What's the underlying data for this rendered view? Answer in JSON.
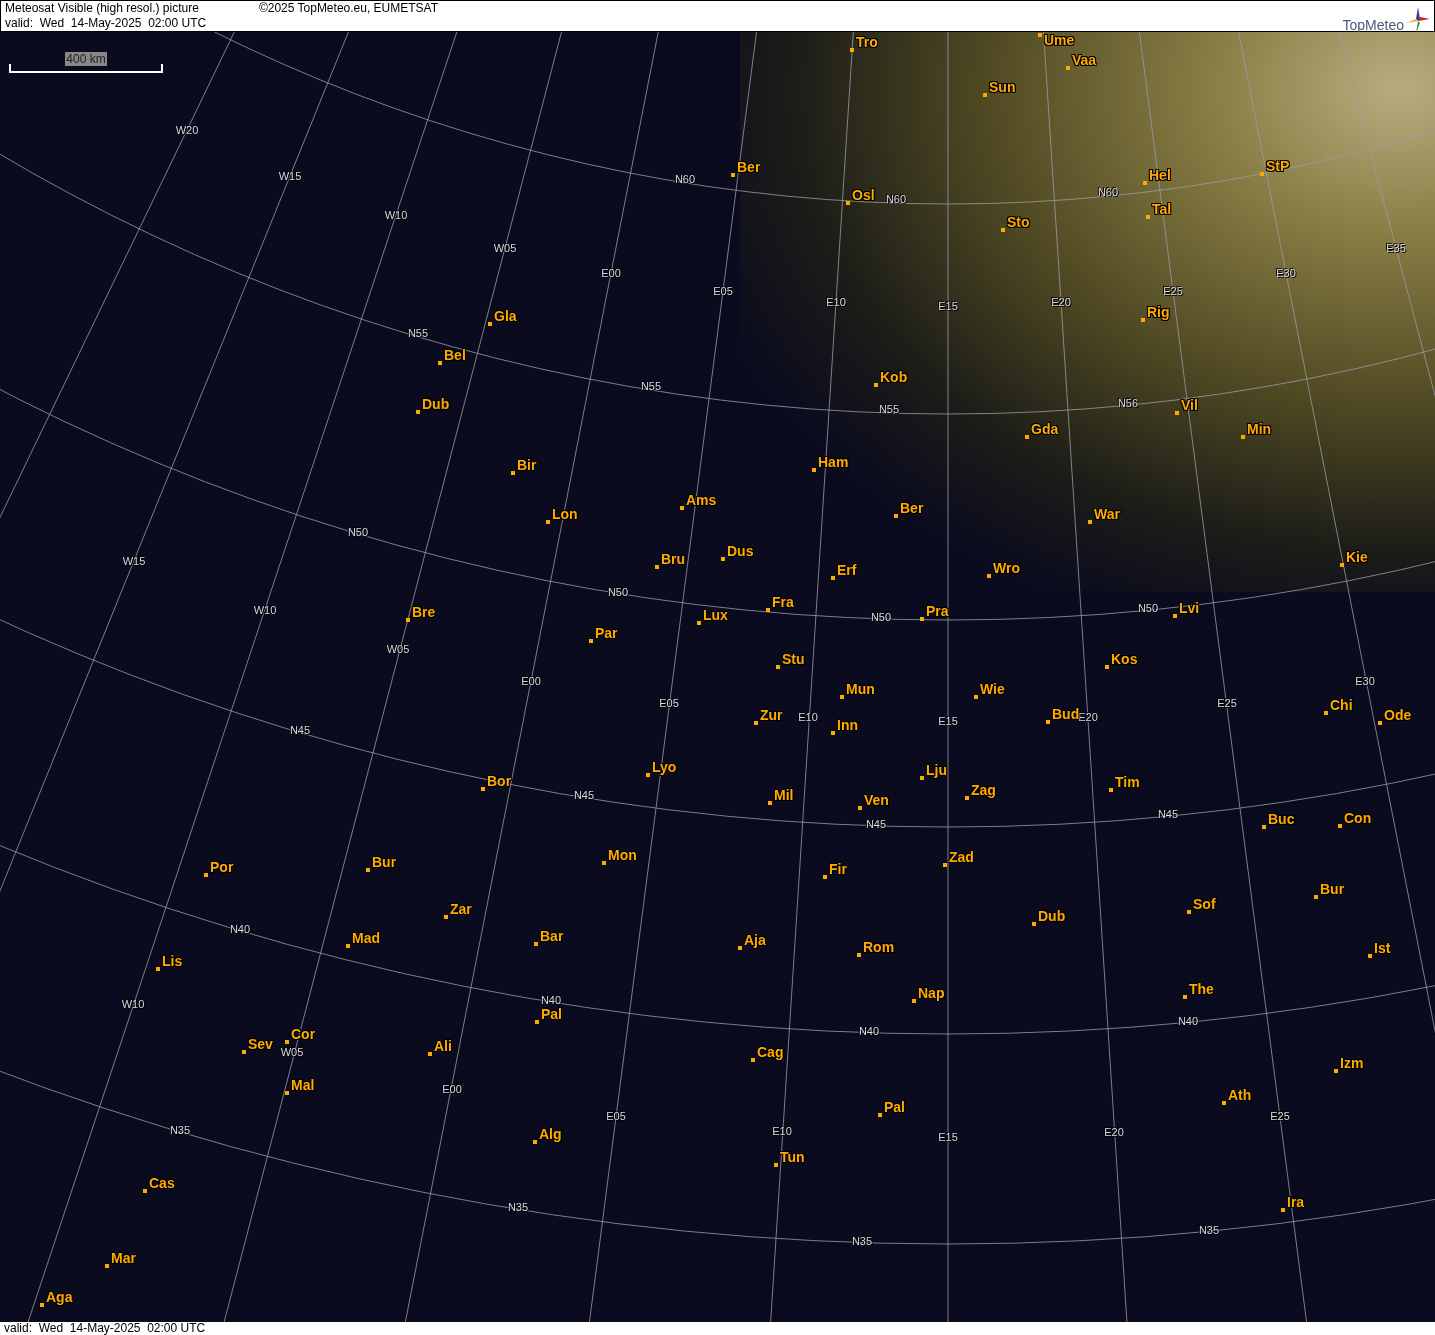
{
  "header": {
    "title": "Meteosat Visible (high resol.) picture",
    "copyright": "©2025 TopMeteo.eu, EUMETSAT",
    "valid": "valid:  Wed  14-May-2025  02:00 UTC",
    "logo": "TopMeteo"
  },
  "scale": {
    "label": "400 km"
  },
  "cities": [
    {
      "name": "Tro"
    },
    {
      "name": "Ume"
    },
    {
      "name": "Vaa"
    },
    {
      "name": "Sun"
    },
    {
      "name": "Ber"
    },
    {
      "name": "Hel"
    },
    {
      "name": "StP"
    },
    {
      "name": "Osl"
    },
    {
      "name": "Sto"
    },
    {
      "name": "Tal"
    },
    {
      "name": "Gla"
    },
    {
      "name": "Rig"
    },
    {
      "name": "Bel"
    },
    {
      "name": "Kob"
    },
    {
      "name": "Dub"
    },
    {
      "name": "Vil"
    },
    {
      "name": "Gda"
    },
    {
      "name": "Min"
    },
    {
      "name": "Bir"
    },
    {
      "name": "Ham"
    },
    {
      "name": "Lon"
    },
    {
      "name": "Ams"
    },
    {
      "name": "Ber"
    },
    {
      "name": "War"
    },
    {
      "name": "Bru"
    },
    {
      "name": "Dus"
    },
    {
      "name": "Kie"
    },
    {
      "name": "Erf"
    },
    {
      "name": "Wro"
    },
    {
      "name": "Bre"
    },
    {
      "name": "Lux"
    },
    {
      "name": "Fra"
    },
    {
      "name": "Pra"
    },
    {
      "name": "Lvi"
    },
    {
      "name": "Par"
    },
    {
      "name": "Stu"
    },
    {
      "name": "Kos"
    },
    {
      "name": "Mun"
    },
    {
      "name": "Wie"
    },
    {
      "name": "Zur"
    },
    {
      "name": "Inn"
    },
    {
      "name": "Bud"
    },
    {
      "name": "Chi"
    },
    {
      "name": "Ode"
    },
    {
      "name": "Lyo"
    },
    {
      "name": "Lju"
    },
    {
      "name": "Bor"
    },
    {
      "name": "Tim"
    },
    {
      "name": "Mil"
    },
    {
      "name": "Ven"
    },
    {
      "name": "Zag"
    },
    {
      "name": "Buc"
    },
    {
      "name": "Con"
    },
    {
      "name": "Por"
    },
    {
      "name": "Bur"
    },
    {
      "name": "Mon"
    },
    {
      "name": "Fir"
    },
    {
      "name": "Zad"
    },
    {
      "name": "Bur"
    },
    {
      "name": "Zar"
    },
    {
      "name": "Sof"
    },
    {
      "name": "Dub"
    },
    {
      "name": "Mad"
    },
    {
      "name": "Bar"
    },
    {
      "name": "Aja"
    },
    {
      "name": "Rom"
    },
    {
      "name": "Ist"
    },
    {
      "name": "Lis"
    },
    {
      "name": "Nap"
    },
    {
      "name": "The"
    },
    {
      "name": "Pal"
    },
    {
      "name": "Sev"
    },
    {
      "name": "Cor"
    },
    {
      "name": "Ali"
    },
    {
      "name": "Cag"
    },
    {
      "name": "Izm"
    },
    {
      "name": "Mal"
    },
    {
      "name": "Ath"
    },
    {
      "name": "Pal"
    },
    {
      "name": "Alg"
    },
    {
      "name": "Tun"
    },
    {
      "name": "Cas"
    },
    {
      "name": "Ira"
    },
    {
      "name": "Mar"
    },
    {
      "name": "Aga"
    }
  ],
  "grid_labels": [
    {
      "label": "W20"
    },
    {
      "label": "W15"
    },
    {
      "label": "W10"
    },
    {
      "label": "W05"
    },
    {
      "label": "E00"
    },
    {
      "label": "E05"
    },
    {
      "label": "E10"
    },
    {
      "label": "E15"
    },
    {
      "label": "E20"
    },
    {
      "label": "E25"
    },
    {
      "label": "E30"
    },
    {
      "label": "E35"
    },
    {
      "label": "N60"
    },
    {
      "label": "N60"
    },
    {
      "label": "N60"
    },
    {
      "label": "N55"
    },
    {
      "label": "N55"
    },
    {
      "label": "N55"
    },
    {
      "label": "N56"
    },
    {
      "label": "N50"
    },
    {
      "label": "N50"
    },
    {
      "label": "N50"
    },
    {
      "label": "N50"
    },
    {
      "label": "W15"
    },
    {
      "label": "W10"
    },
    {
      "label": "W05"
    },
    {
      "label": "E00"
    },
    {
      "label": "E05"
    },
    {
      "label": "E10"
    },
    {
      "label": "E15"
    },
    {
      "label": "E20"
    },
    {
      "label": "E25"
    },
    {
      "label": "E30"
    },
    {
      "label": "N45"
    },
    {
      "label": "N45"
    },
    {
      "label": "N45"
    },
    {
      "label": "N45"
    },
    {
      "label": "N40"
    },
    {
      "label": "N40"
    },
    {
      "label": "N40"
    },
    {
      "label": "N40"
    },
    {
      "label": "W10"
    },
    {
      "label": "W05"
    },
    {
      "label": "E00"
    },
    {
      "label": "E05"
    },
    {
      "label": "E10"
    },
    {
      "label": "E15"
    },
    {
      "label": "E20"
    },
    {
      "label": "E25"
    },
    {
      "label": "N35"
    },
    {
      "label": "N35"
    },
    {
      "label": "N35"
    },
    {
      "label": "N35"
    }
  ],
  "footer": {
    "valid": "valid:  Wed  14-May-2025  02:00 UTC"
  }
}
